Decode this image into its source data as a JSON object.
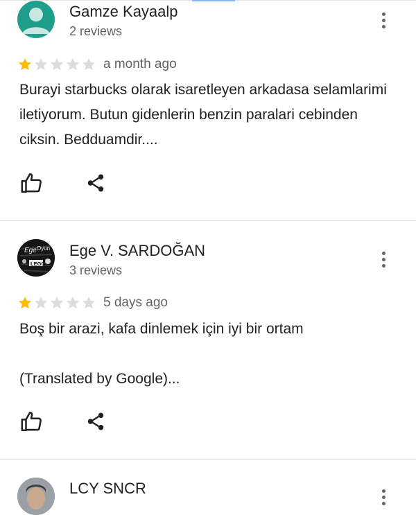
{
  "colors": {
    "star_filled": "#fbbc04",
    "star_empty": "#dadce0",
    "avatar_teal": "#1f9e8c",
    "accent": "#8ab4f8"
  },
  "icons": {
    "like": "thumbs-up-icon",
    "share": "share-icon",
    "menu": "more-vert-icon"
  },
  "reviews": [
    {
      "name": "Gamze Kayaalp",
      "review_count": "2 reviews",
      "rating": 1,
      "date": "a month ago",
      "text": "Burayi starbucks olarak isaretleyen arkadasa selamlarimi iletiyorum. Butun gidenlerin benzin paralari cebinden ciksin. Bedduamdir....",
      "translation_note": ""
    },
    {
      "name": "Ege V. SARDOĞAN",
      "review_count": "3 reviews",
      "rating": 1,
      "date": "5 days ago",
      "text": "Boş bir arazi, kafa dinlemek için iyi bir ortam",
      "translation_note": "(Translated by Google)..."
    },
    {
      "name": "LCY SNCR",
      "review_count": "",
      "rating": 0,
      "date": "",
      "text": "",
      "translation_note": ""
    }
  ],
  "avatar_text": {
    "line1": "Ege",
    "line2": "Oyun",
    "line3": "LEGO"
  }
}
